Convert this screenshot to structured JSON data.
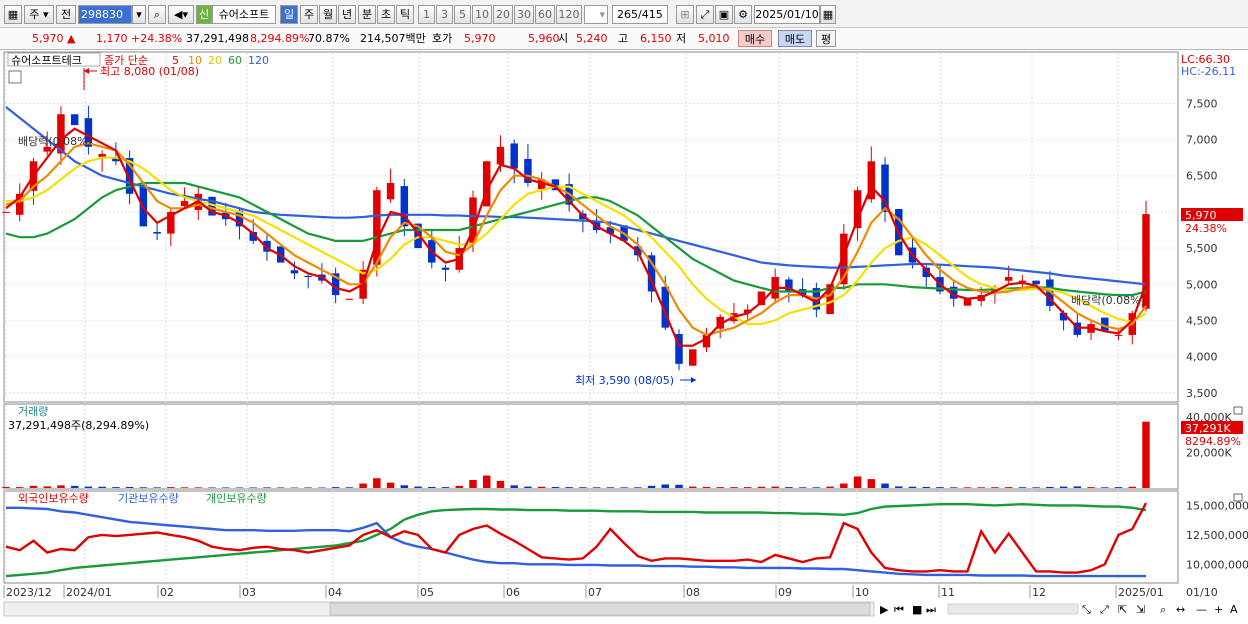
{
  "toolbar": {
    "mode_label": "주",
    "prev_label": "전",
    "code_value": "298830",
    "new_badge": "신",
    "stock_name": "슈어소프트",
    "period_day": "일",
    "period_week": "주",
    "period_month": "월",
    "period_year": "년",
    "period_min": "분",
    "period_sec": "초",
    "period_tick": "틱",
    "intervals": [
      "1",
      "3",
      "5",
      "10",
      "20",
      "30",
      "60",
      "120"
    ],
    "count_value": "265",
    "count_total": "/415",
    "date_value": "2025/01/10"
  },
  "quote": {
    "price": "5,970",
    "change_arrow": "▲",
    "change": "1,170",
    "change_pct": "+24.38%",
    "volume": "37,291,498",
    "volume_ratio": "8,294.89%",
    "turnover_ratio": "70.87%",
    "amount": "214,507백만",
    "ask_label": "호가",
    "ask_value": "5,970",
    "bid_value": "5,960",
    "open_label": "시",
    "open_value": "5,240",
    "high_label": "고",
    "high_value": "6,150",
    "low_label": "저",
    "low_value": "5,010",
    "buy_label": "매수",
    "sell_label": "매도",
    "avg_label": "평"
  },
  "panel_price": {
    "title": "슈어소프트테크",
    "ma_label": "종가 단순",
    "ma_periods": [
      "5",
      "10",
      "20",
      "60",
      "120"
    ],
    "ma_colors": [
      "#e00000",
      "#f08a00",
      "#f5e000",
      "#1a9a3a",
      "#3060e0"
    ],
    "high_annotation": "최고 8,080 (01/08)",
    "low_annotation": "최저 3,590 (08/05)",
    "dividend1": "배당락(0.08%)",
    "dividend2": "배당락(0.08%)",
    "lc": "LC:66.30",
    "hc": "HC:-26.11",
    "price_ticks": [
      "7,500",
      "7,000",
      "6,500",
      "6,000",
      "5,500",
      "5,000",
      "4,500",
      "4,000",
      "3,500"
    ],
    "current_price_tag": "5,970",
    "current_pct_tag": "24.38%"
  },
  "panel_volume": {
    "title": "거래량",
    "value_text": "37,291,498주(8,294.89%)",
    "ticks": [
      "40,000K",
      "20,000K"
    ],
    "current_tag": "37,291K",
    "current_pct_tag": "8294.89%"
  },
  "panel_holdings": {
    "legend": [
      "외국인보유수량",
      "기관보유수량",
      "개인보유수량"
    ],
    "legend_colors": [
      "#e00000",
      "#3060e0",
      "#1a9a3a"
    ],
    "ticks": [
      "15,000,000",
      "12,500,000",
      "10,000,000"
    ]
  },
  "x_axis": {
    "labels": [
      "2023/12",
      "2024/01",
      "02",
      "03",
      "04",
      "05",
      "06",
      "07",
      "08",
      "09",
      "10",
      "11",
      "12",
      "2025/01",
      "01/10"
    ]
  },
  "chart_data": {
    "type": "line",
    "title": "슈어소프트테크",
    "y_range": [
      3400,
      8100
    ],
    "volume_range_k": [
      0,
      45000
    ],
    "holdings_range": [
      8500000,
      15800000
    ],
    "series": [
      {
        "name": "종가",
        "values": [
          6000,
          6250,
          6700,
          6900,
          7350,
          7200,
          6900,
          6800,
          6700,
          6250,
          5800,
          5700,
          6000,
          6150,
          6250,
          5950,
          5900,
          5800,
          5600,
          5450,
          5300,
          5150,
          5100,
          5050,
          4850,
          4800,
          5200,
          6300,
          6400,
          5800,
          5500,
          5300,
          5200,
          5500,
          6200,
          6700,
          6900,
          6600,
          6400,
          6450,
          6300,
          6100,
          5900,
          5750,
          5700,
          5600,
          5400,
          4900,
          4400,
          3900,
          4100,
          4300,
          4550,
          4600,
          4650,
          4900,
          5100,
          4900,
          4850,
          4650,
          5000,
          5700,
          6300,
          6700,
          6000,
          5400,
          5300,
          5100,
          4900,
          4800,
          4800,
          4850,
          4950,
          5100,
          5050,
          5000,
          4700,
          4500,
          4300,
          4450,
          4350,
          4300,
          4600,
          5970
        ]
      },
      {
        "name": "5",
        "values": [
          6050,
          6200,
          6500,
          6750,
          7000,
          7150,
          7050,
          6950,
          6850,
          6450,
          6050,
          5850,
          5950,
          6050,
          6150,
          6000,
          5950,
          5850,
          5700,
          5500,
          5400,
          5250,
          5150,
          5100,
          4950,
          4900,
          5000,
          5600,
          6000,
          5950,
          5700,
          5450,
          5300,
          5350,
          5750,
          6300,
          6650,
          6600,
          6450,
          6400,
          6350,
          6150,
          5950,
          5800,
          5700,
          5600,
          5450,
          5050,
          4600,
          4150,
          4150,
          4250,
          4450,
          4550,
          4600,
          4750,
          4950,
          4950,
          4850,
          4750,
          4950,
          5400,
          5900,
          6350,
          6150,
          5700,
          5400,
          5200,
          5000,
          4850,
          4800,
          4820,
          4900,
          5000,
          5020,
          4980,
          4800,
          4600,
          4400,
          4400,
          4350,
          4320,
          4500,
          5000
        ]
      },
      {
        "name": "10",
        "values": [
          6100,
          6150,
          6350,
          6500,
          6700,
          6900,
          6950,
          6900,
          6850,
          6650,
          6400,
          6150,
          6050,
          6050,
          6100,
          6050,
          6000,
          5950,
          5850,
          5700,
          5550,
          5400,
          5300,
          5200,
          5100,
          5000,
          5000,
          5300,
          5650,
          5850,
          5800,
          5650,
          5450,
          5400,
          5550,
          5950,
          6300,
          6500,
          6500,
          6450,
          6350,
          6250,
          6100,
          5950,
          5800,
          5700,
          5550,
          5300,
          5000,
          4650,
          4400,
          4300,
          4350,
          4400,
          4500,
          4600,
          4750,
          4850,
          4850,
          4800,
          4850,
          5100,
          5450,
          5850,
          6050,
          5900,
          5650,
          5400,
          5200,
          5050,
          4950,
          4900,
          4880,
          4900,
          4950,
          4980,
          4900,
          4750,
          4600,
          4500,
          4420,
          4380,
          4450,
          4700
        ]
      },
      {
        "name": "20",
        "values": [
          6150,
          6150,
          6200,
          6300,
          6450,
          6600,
          6700,
          6750,
          6750,
          6700,
          6600,
          6450,
          6300,
          6200,
          6150,
          6100,
          6050,
          6000,
          5950,
          5850,
          5750,
          5650,
          5550,
          5450,
          5350,
          5250,
          5150,
          5200,
          5350,
          5550,
          5650,
          5650,
          5600,
          5550,
          5550,
          5700,
          5900,
          6100,
          6250,
          6300,
          6350,
          6350,
          6250,
          6150,
          6050,
          5950,
          5800,
          5650,
          5450,
          5250,
          5000,
          4800,
          4650,
          4550,
          4450,
          4450,
          4500,
          4600,
          4650,
          4700,
          4750,
          4850,
          5050,
          5300,
          5500,
          5600,
          5650,
          5550,
          5400,
          5250,
          5100,
          5000,
          4950,
          4920,
          4920,
          4940,
          4930,
          4880,
          4800,
          4700,
          4600,
          4520,
          4480,
          4600
        ]
      },
      {
        "name": "60",
        "values": [
          5700,
          5650,
          5650,
          5700,
          5800,
          5900,
          6050,
          6200,
          6300,
          6350,
          6400,
          6400,
          6400,
          6400,
          6350,
          6300,
          6250,
          6200,
          6100,
          6000,
          5900,
          5800,
          5700,
          5650,
          5600,
          5600,
          5600,
          5650,
          5700,
          5750,
          5750,
          5750,
          5750,
          5750,
          5800,
          5850,
          5900,
          5950,
          6000,
          6050,
          6100,
          6150,
          6200,
          6200,
          6150,
          6050,
          5950,
          5800,
          5650,
          5500,
          5350,
          5250,
          5150,
          5050,
          5000,
          4950,
          4900,
          4900,
          4900,
          4900,
          4950,
          4950,
          5000,
          5000,
          5000,
          4980,
          4960,
          4950,
          4940,
          4930,
          4920,
          4920,
          4930,
          4940,
          4950,
          4960,
          4950,
          4920,
          4900,
          4880,
          4860,
          4850,
          4850,
          4900
        ]
      },
      {
        "name": "120",
        "values": [
          7450,
          7300,
          7150,
          7000,
          6850,
          6700,
          6600,
          6500,
          6450,
          6400,
          6350,
          6300,
          6250,
          6220,
          6180,
          6150,
          6100,
          6050,
          6000,
          5980,
          5960,
          5950,
          5940,
          5930,
          5920,
          5920,
          5930,
          5950,
          5960,
          5960,
          5960,
          5960,
          5950,
          5950,
          5940,
          5940,
          5930,
          5930,
          5920,
          5910,
          5900,
          5890,
          5880,
          5870,
          5850,
          5800,
          5750,
          5700,
          5650,
          5600,
          5550,
          5500,
          5450,
          5400,
          5350,
          5300,
          5280,
          5260,
          5250,
          5240,
          5230,
          5230,
          5240,
          5250,
          5260,
          5270,
          5280,
          5280,
          5270,
          5260,
          5250,
          5240,
          5230,
          5210,
          5190,
          5170,
          5150,
          5120,
          5100,
          5080,
          5060,
          5040,
          5020,
          5000
        ]
      },
      {
        "name": "거래량(K)",
        "values": [
          600,
          500,
          1200,
          900,
          1500,
          1200,
          800,
          700,
          500,
          600,
          400,
          350,
          500,
          400,
          350,
          300,
          300,
          280,
          300,
          350,
          300,
          250,
          300,
          280,
          500,
          400,
          2500,
          5500,
          3000,
          1500,
          800,
          600,
          500,
          1200,
          4500,
          7000,
          4000,
          1500,
          800,
          700,
          600,
          500,
          450,
          400,
          400,
          380,
          400,
          1200,
          2000,
          1800,
          800,
          600,
          500,
          500,
          500,
          700,
          800,
          500,
          400,
          400,
          800,
          2500,
          6500,
          5000,
          2500,
          900,
          700,
          600,
          500,
          400,
          400,
          400,
          450,
          500,
          450,
          400,
          600,
          800,
          900,
          500,
          400,
          500,
          700,
          37291
        ]
      },
      {
        "name": "외국인보유수량",
        "values": [
          11500000,
          11200000,
          12000000,
          11000000,
          11300000,
          11200000,
          12300000,
          12500000,
          12400000,
          12500000,
          12600000,
          12700000,
          12500000,
          12300000,
          12000000,
          11500000,
          11300000,
          11200000,
          11400000,
          11500000,
          11300000,
          11200000,
          11000000,
          11200000,
          11400000,
          11600000,
          12500000,
          12900000,
          12300000,
          12800000,
          12500000,
          11300000,
          11000000,
          12500000,
          13000000,
          13300000,
          12600000,
          12000000,
          11300000,
          10600000,
          10500000,
          10400000,
          10500000,
          11500000,
          13000000,
          11800000,
          10700000,
          10300000,
          10500000,
          10500000,
          10400000,
          10300000,
          10300000,
          10300000,
          10400000,
          10200000,
          10800000,
          10500000,
          10200000,
          10500000,
          10600000,
          13500000,
          13000000,
          11000000,
          9700000,
          9500000,
          9400000,
          9400000,
          9500000,
          9400000,
          9400000,
          12800000,
          11000000,
          12600000,
          11000000,
          9400000,
          9400000,
          9300000,
          9300000,
          9500000,
          10000000,
          12500000,
          13000000,
          15200000
        ]
      },
      {
        "name": "기관보유수량",
        "values": [
          14800000,
          14800000,
          14750000,
          14700000,
          14500000,
          14400000,
          14200000,
          14000000,
          13800000,
          13600000,
          13500000,
          13400000,
          13300000,
          13200000,
          13100000,
          13000000,
          12900000,
          12900000,
          12900000,
          12850000,
          12850000,
          12850000,
          12900000,
          12900000,
          12900000,
          12800000,
          13100000,
          13500000,
          12300000,
          11800000,
          11500000,
          11300000,
          11000000,
          10700000,
          10400000,
          10200000,
          10100000,
          10100000,
          10000000,
          10000000,
          10000000,
          9950000,
          9950000,
          9950000,
          9900000,
          9900000,
          9900000,
          9850000,
          9850000,
          9850000,
          9800000,
          9800000,
          9750000,
          9750000,
          9700000,
          9700000,
          9700000,
          9700000,
          9650000,
          9650000,
          9600000,
          9600000,
          9500000,
          9400000,
          9300000,
          9200000,
          9150000,
          9100000,
          9100000,
          9100000,
          9100000,
          9050000,
          9050000,
          9050000,
          9050000,
          9000000,
          9000000,
          9000000,
          9000000,
          9000000,
          9000000,
          9000000,
          9000000,
          9000000
        ]
      },
      {
        "name": "개인보유수량",
        "values": [
          9000000,
          9100000,
          9200000,
          9300000,
          9500000,
          9700000,
          9800000,
          9900000,
          10000000,
          10100000,
          10200000,
          10300000,
          10400000,
          10500000,
          10600000,
          10700000,
          10800000,
          10900000,
          11000000,
          11100000,
          11200000,
          11300000,
          11400000,
          11500000,
          11600000,
          11800000,
          12000000,
          12500000,
          13000000,
          13800000,
          14200000,
          14500000,
          14600000,
          14650000,
          14700000,
          14700000,
          14650000,
          14650000,
          14600000,
          14600000,
          14600000,
          14550000,
          14550000,
          14550000,
          14500000,
          14500000,
          14500000,
          14450000,
          14450000,
          14450000,
          14450000,
          14400000,
          14400000,
          14400000,
          14400000,
          14400000,
          14350000,
          14350000,
          14300000,
          14300000,
          14250000,
          14200000,
          14350000,
          14700000,
          14900000,
          14950000,
          15000000,
          15050000,
          15100000,
          15100000,
          15100000,
          15050000,
          15000000,
          15050000,
          15100000,
          15050000,
          15000000,
          15000000,
          15000000,
          14950000,
          14900000,
          14900000,
          14800000,
          14600000
        ]
      }
    ]
  }
}
